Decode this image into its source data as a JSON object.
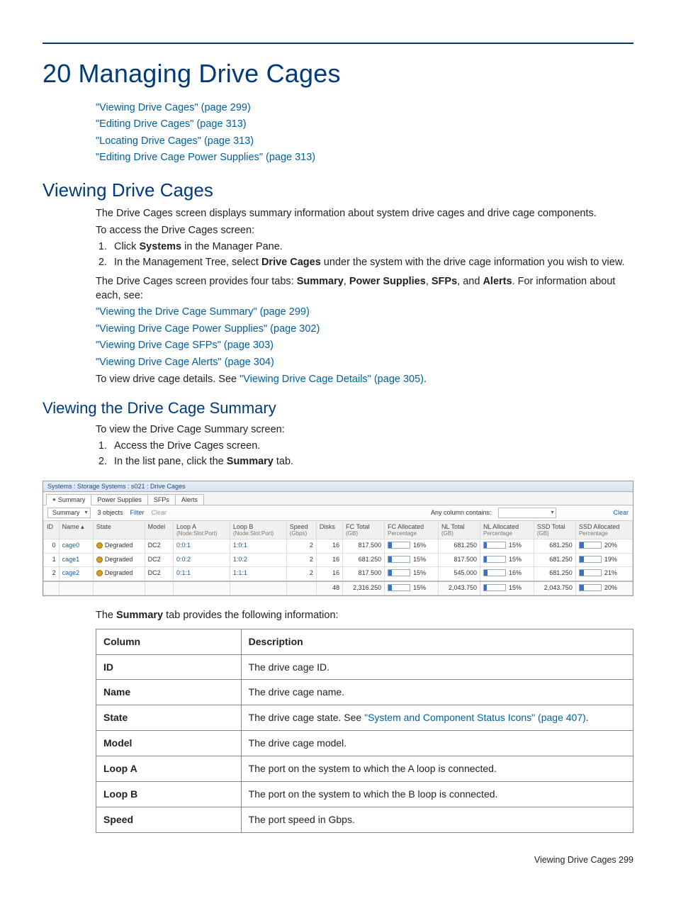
{
  "chapter_number": "20",
  "chapter_title": "Managing Drive Cages",
  "top_links": [
    "\"Viewing Drive Cages\" (page 299)",
    "\"Editing Drive Cages\" (page 313)",
    "\"Locating Drive Cages\" (page 313)",
    "\"Editing Drive Cage Power Supplies\" (page 313)"
  ],
  "h2a": "Viewing Drive Cages",
  "p1": "The Drive Cages screen displays summary information about system drive cages and drive cage components.",
  "p2": "To access the Drive Cages screen:",
  "step1_pre": "Click ",
  "step1_bold": "Systems",
  "step1_post": " in the Manager Pane.",
  "step2_pre": "In the Management Tree, select ",
  "step2_bold": "Drive Cages",
  "step2_post": " under the system with the drive cage information you wish to view.",
  "tabs_sentence_pre": "The Drive Cages screen provides four tabs: ",
  "tabs_b1": "Summary",
  "tabs_b2": "Power Supplies",
  "tabs_b3": "SFPs",
  "tabs_sep_and": ", and ",
  "tabs_b4": "Alerts",
  "tabs_sentence_post": ". For information about each, see:",
  "sublinks": [
    "\"Viewing the Drive Cage Summary\" (page 299)",
    "\"Viewing Drive Cage Power Supplies\" (page 302)",
    "\"Viewing Drive Cage SFPs\" (page 303)",
    "\"Viewing Drive Cage Alerts\" (page 304)"
  ],
  "detail_sentence_pre": "To view drive cage details. See ",
  "detail_link": "\"Viewing Drive Cage Details\" (page 305)",
  "detail_sentence_post": ".",
  "h3a": "Viewing the Drive Cage Summary",
  "p3": "To view the Drive Cage Summary screen:",
  "step3": "Access the Drive Cages screen.",
  "step4_pre": "In the list pane, click the ",
  "step4_bold": "Summary",
  "step4_post": " tab.",
  "shot": {
    "title": "Systems : Storage Systems : s021 : Drive Cages",
    "tabs": [
      "Summary",
      "Power Supplies",
      "SFPs",
      "Alerts"
    ],
    "toolbar": {
      "current_tab": "Summary",
      "objects": "3 objects",
      "filter": "Filter",
      "clear1": "Clear",
      "anycol": "Any column contains:",
      "clear2": "Clear"
    },
    "headers": {
      "id": "ID",
      "name": "Name",
      "state": "State",
      "model": "Model",
      "loopa": "Loop A",
      "loopa_sub": "(Node:Slot:Port)",
      "loopb": "Loop B",
      "loopb_sub": "(Node:Slot:Port)",
      "speed": "Speed",
      "speed_sub": "(Gbps)",
      "disks": "Disks",
      "fctotal": "FC Total",
      "fctotal_sub": "(GB)",
      "fcalloc": "FC Allocated",
      "fcalloc_sub": "Percentage",
      "nltotal": "NL Total",
      "nltotal_sub": "(GB)",
      "nlalloc": "NL Allocated",
      "nlalloc_sub": "Percentage",
      "ssdtotal": "SSD Total",
      "ssdtotal_sub": "(GB)",
      "ssdalloc": "SSD Allocated",
      "ssdalloc_sub": "Percentage"
    },
    "rows": [
      {
        "id": "0",
        "name": "cage0",
        "state": "Degraded",
        "model": "DC2",
        "loopa": "0:0:1",
        "loopb": "1:0:1",
        "speed": "2",
        "disks": "16",
        "fct": "817.500",
        "fca": "16%",
        "fcp": 16,
        "nlt": "681.250",
        "nla": "15%",
        "nlp": 15,
        "sst": "681.250",
        "ssa": "20%",
        "ssp": 20
      },
      {
        "id": "1",
        "name": "cage1",
        "state": "Degraded",
        "model": "DC2",
        "loopa": "0:0:2",
        "loopb": "1:0:2",
        "speed": "2",
        "disks": "16",
        "fct": "681.250",
        "fca": "15%",
        "fcp": 15,
        "nlt": "817.500",
        "nla": "15%",
        "nlp": 15,
        "sst": "681.250",
        "ssa": "19%",
        "ssp": 19
      },
      {
        "id": "2",
        "name": "cage2",
        "state": "Degraded",
        "model": "DC2",
        "loopa": "0:1:1",
        "loopb": "1:1:1",
        "speed": "2",
        "disks": "16",
        "fct": "817.500",
        "fca": "15%",
        "fcp": 15,
        "nlt": "545.000",
        "nla": "16%",
        "nlp": 16,
        "sst": "681.250",
        "ssa": "21%",
        "ssp": 21
      }
    ],
    "totals": {
      "disks": "48",
      "fct": "2,316.250",
      "fca": "15%",
      "fcp": 15,
      "nlt": "2,043.750",
      "nla": "15%",
      "nlp": 15,
      "sst": "2,043.750",
      "ssa": "20%",
      "ssp": 20
    }
  },
  "summary_caption_pre": "The ",
  "summary_caption_bold": "Summary",
  "summary_caption_post": " tab provides the following information:",
  "desc_headers": {
    "col": "Column",
    "desc": "Description"
  },
  "desc_rows": [
    {
      "c": "ID",
      "d_pre": "The drive cage ID.",
      "link": ""
    },
    {
      "c": "Name",
      "d_pre": "The drive cage name.",
      "link": ""
    },
    {
      "c": "State",
      "d_pre": "The drive cage state. See ",
      "link": "\"System and Component Status Icons\" (page 407)",
      "d_post": "."
    },
    {
      "c": "Model",
      "d_pre": "The drive cage model.",
      "link": ""
    },
    {
      "c": "Loop A",
      "d_pre": "The port on the system to which the A loop is connected.",
      "link": ""
    },
    {
      "c": "Loop B",
      "d_pre": "The port on the system to which the B loop is connected.",
      "link": ""
    },
    {
      "c": "Speed",
      "d_pre": "The port speed in Gbps.",
      "link": ""
    }
  ],
  "footer": "Viewing Drive Cages   299"
}
